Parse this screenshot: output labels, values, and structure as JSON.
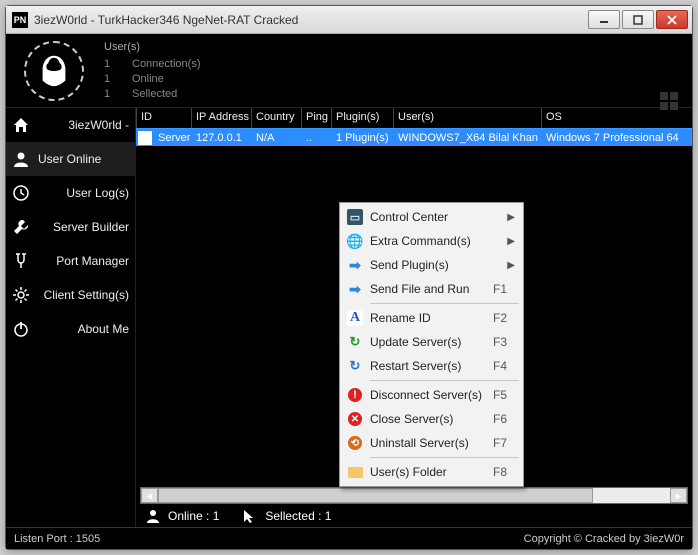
{
  "title": "3iezW0rld - TurkHacker346 NgeNet-RAT Cracked",
  "app_icon": "PN",
  "stats": {
    "users_label": "User(s)",
    "rows": [
      {
        "n": "1",
        "label": "Connection(s)"
      },
      {
        "n": "1",
        "label": "Online"
      },
      {
        "n": "1",
        "label": "Sellected"
      }
    ]
  },
  "sidebar": {
    "items": [
      {
        "label": "3iezW0rld -",
        "icon": "home",
        "align": "right"
      },
      {
        "label": "User Online",
        "icon": "user",
        "active": true,
        "align": "left"
      },
      {
        "label": "User Log(s)",
        "icon": "clock",
        "align": "right"
      },
      {
        "label": "Server Builder",
        "icon": "wrench",
        "align": "right"
      },
      {
        "label": "Port Manager",
        "icon": "port",
        "align": "right"
      },
      {
        "label": "Client Setting(s)",
        "icon": "gear",
        "align": "right"
      },
      {
        "label": "About Me",
        "icon": "power",
        "align": "right"
      }
    ]
  },
  "columns": {
    "id": "ID",
    "ip": "IP Address",
    "country": "Country",
    "ping": "Ping",
    "plugin": "Plugin(s)",
    "users": "User(s)",
    "os": "OS"
  },
  "row": {
    "id": "Server",
    "ip": "127.0.0.1",
    "country": "N/A",
    "ping": "..",
    "plugin": "1 Plugin(s)",
    "users": "WINDOWS7_X64 Bilal Khan",
    "os": "Windows 7 Professional 64"
  },
  "context_menu": [
    {
      "label": "Control Center",
      "icon": "monitor",
      "sub": true
    },
    {
      "label": "Extra Command(s)",
      "icon": "globe",
      "sub": true
    },
    {
      "label": "Send Plugin(s)",
      "icon": "arrow",
      "sub": true
    },
    {
      "label": "Send File and Run",
      "icon": "arrow2",
      "shortcut": "F1"
    },
    {
      "sep": true
    },
    {
      "label": "Rename ID",
      "icon": "A",
      "shortcut": "F2"
    },
    {
      "label": "Update Server(s)",
      "icon": "refresh",
      "shortcut": "F3"
    },
    {
      "label": "Restart Server(s)",
      "icon": "refresh2",
      "shortcut": "F4"
    },
    {
      "sep": true
    },
    {
      "label": "Disconnect Server(s)",
      "icon": "bang",
      "shortcut": "F5"
    },
    {
      "label": "Close Server(s)",
      "icon": "x",
      "shortcut": "F6"
    },
    {
      "label": "Uninstall Server(s)",
      "icon": "uninst",
      "shortcut": "F7"
    },
    {
      "sep": true
    },
    {
      "label": "User(s) Folder",
      "icon": "folder",
      "shortcut": "F8"
    }
  ],
  "status": {
    "online": "Online : 1",
    "selected": "Sellected : 1"
  },
  "footer": {
    "left": "Listen Port : 1505",
    "right": "Copyright © Cracked by 3iezW0r"
  }
}
